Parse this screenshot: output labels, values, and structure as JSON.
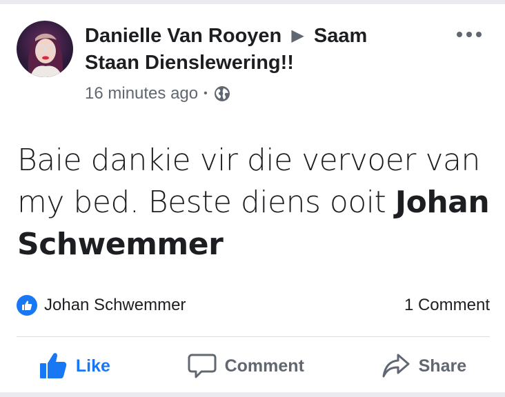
{
  "post": {
    "author": "Danielle Van Rooyen",
    "target": "Saam Staan Dienslewering!!",
    "timestamp": "16 minutes ago",
    "privacy_icon": "globe-icon",
    "text_plain": "Baie dankie vir die vervoer van my bed.  Beste diens ooit",
    "text_tag": "Johan Schwemmer"
  },
  "reactions": {
    "liker": "Johan Schwemmer",
    "comments": "1 Comment"
  },
  "actions": {
    "like": "Like",
    "comment": "Comment",
    "share": "Share"
  },
  "colors": {
    "accent": "#1877f2",
    "muted": "#606770",
    "text": "#1c1e21"
  }
}
